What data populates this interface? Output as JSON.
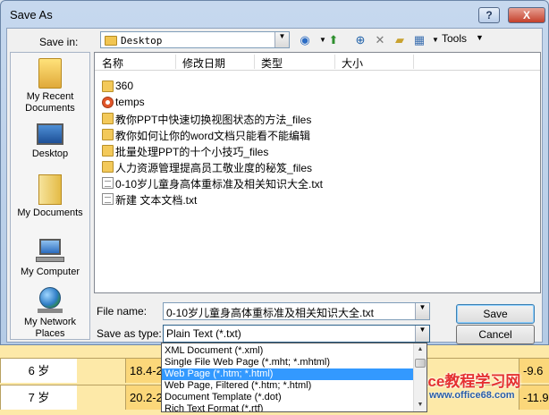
{
  "window": {
    "title": "Save As",
    "help_glyph": "?",
    "close_glyph": "X"
  },
  "toolbar": {
    "save_in_label": "Save in:",
    "save_in_value": "Desktop",
    "tools_label": "Tools",
    "icons": [
      "back-icon",
      "up-folder-icon",
      "search-web-icon",
      "delete-icon",
      "new-folder-icon",
      "views-icon"
    ]
  },
  "places": [
    {
      "label": "My Recent Documents",
      "icon": "recent-folder-icon"
    },
    {
      "label": "Desktop",
      "icon": "desktop-icon"
    },
    {
      "label": "My Documents",
      "icon": "my-documents-icon"
    },
    {
      "label": "My Computer",
      "icon": "computer-icon"
    },
    {
      "label": "My Network Places",
      "icon": "network-icon"
    }
  ],
  "file_list": {
    "columns": [
      "名称",
      "修改日期",
      "类型",
      "大小"
    ],
    "items": [
      {
        "name": "360",
        "kind": "folder"
      },
      {
        "name": "temps",
        "kind": "office"
      },
      {
        "name": "教你PPT中快速切换视图状态的方法_files",
        "kind": "folder"
      },
      {
        "name": "教你如何让你的word文档只能看不能编辑",
        "kind": "folder"
      },
      {
        "name": "批量处理PPT的十个小技巧_files",
        "kind": "folder"
      },
      {
        "name": "人力资源管理提高员工敬业度的秘笈_files",
        "kind": "folder"
      },
      {
        "name": "0-10岁儿童身高体重标准及相关知识大全.txt",
        "kind": "text"
      },
      {
        "name": "新建 文本文档.txt",
        "kind": "text"
      }
    ]
  },
  "form": {
    "file_name_label": "File name:",
    "file_name_value": "0-10岁儿童身高体重标准及相关知识大全.txt",
    "save_as_type_label": "Save as type:",
    "save_as_type_value": "Plain Text (*.txt)",
    "save_button": "Save",
    "cancel_button": "Cancel"
  },
  "type_dropdown": {
    "options": [
      "XML Document (*.xml)",
      "Single File Web Page (*.mht; *.mhtml)",
      "Web Page (*.htm; *.html)",
      "Web Page, Filtered (*.htm; *.html)",
      "Document Template (*.dot)",
      "Rich Text Format (*.rtf)"
    ],
    "selected_index": 2
  },
  "background_sheet": {
    "rows": [
      {
        "label": "6 岁",
        "value": "18.4-2",
        "right": "-9.6"
      },
      {
        "label": "7 岁",
        "value": "20.2-2",
        "right": "-11.9"
      }
    ]
  },
  "watermark": {
    "text": "office教程学习网",
    "url": "www.office68.com"
  },
  "colors": {
    "selection": "#3399ff",
    "title_bar": "#c6d8ee",
    "close_button": "#c4402b",
    "sheet_fill": "#fbd77a"
  }
}
